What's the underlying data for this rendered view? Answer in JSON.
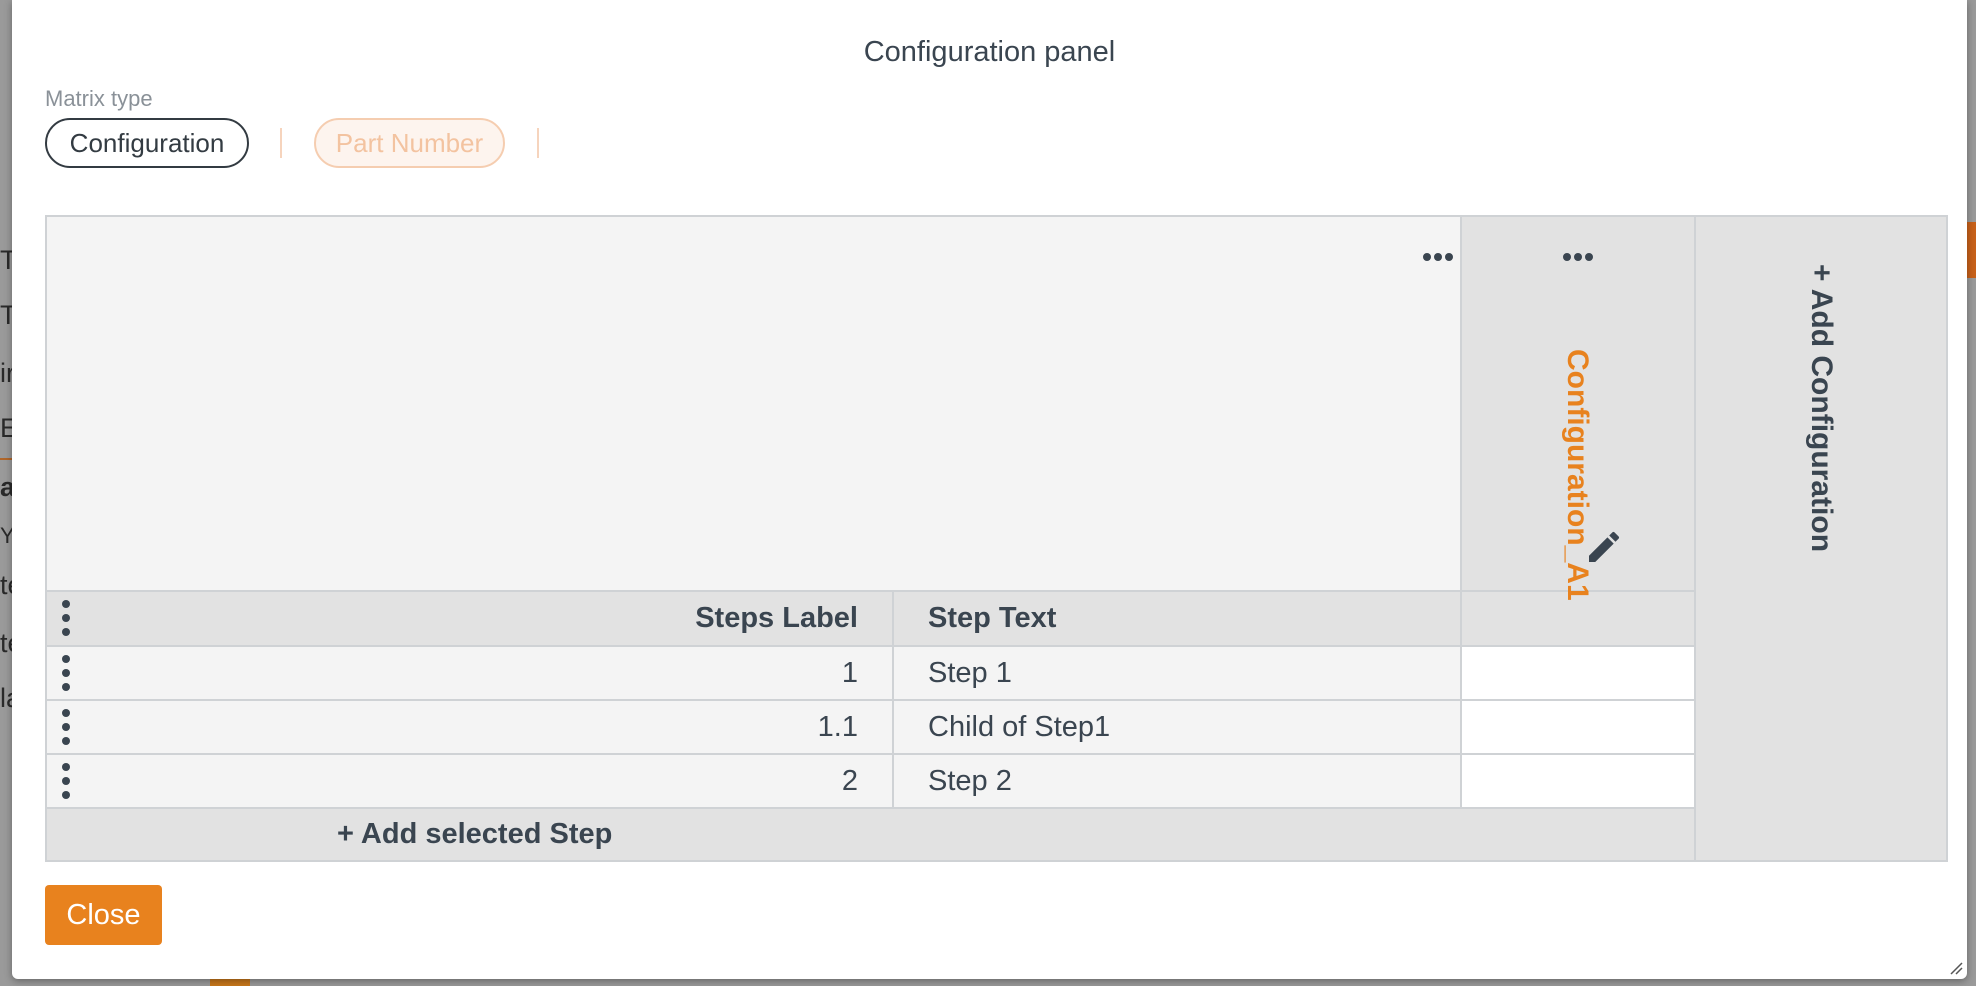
{
  "background": {
    "letters": [
      "T",
      "T",
      "ir",
      "E",
      "a",
      "Y",
      "te",
      "te",
      "la"
    ]
  },
  "modal": {
    "title": "Configuration panel",
    "matrix_type_label": "Matrix type",
    "matrix_types": [
      {
        "label": "Configuration",
        "selected": true
      },
      {
        "label": "Part Number",
        "selected": false
      }
    ],
    "table": {
      "columns": {
        "steps_label": "Steps Label",
        "step_text": "Step Text"
      },
      "configuration_column": "Configuration_A1",
      "add_configuration": "+ Add Configuration",
      "rows": [
        {
          "label": "1",
          "text": "Step 1"
        },
        {
          "label": "1.1",
          "text": "Child of Step1"
        },
        {
          "label": "2",
          "text": "Step 2"
        }
      ],
      "add_step": "+ Add selected Step"
    },
    "close_label": "Close"
  },
  "colors": {
    "accent": "#e8821e",
    "text": "#3a4550",
    "header_bg": "#e2e2e2",
    "cell_bg": "#f4f4f4"
  },
  "icons": [
    "kebab-menu-icon",
    "more-horizontal-icon",
    "pencil-icon",
    "resize-handle-icon"
  ]
}
